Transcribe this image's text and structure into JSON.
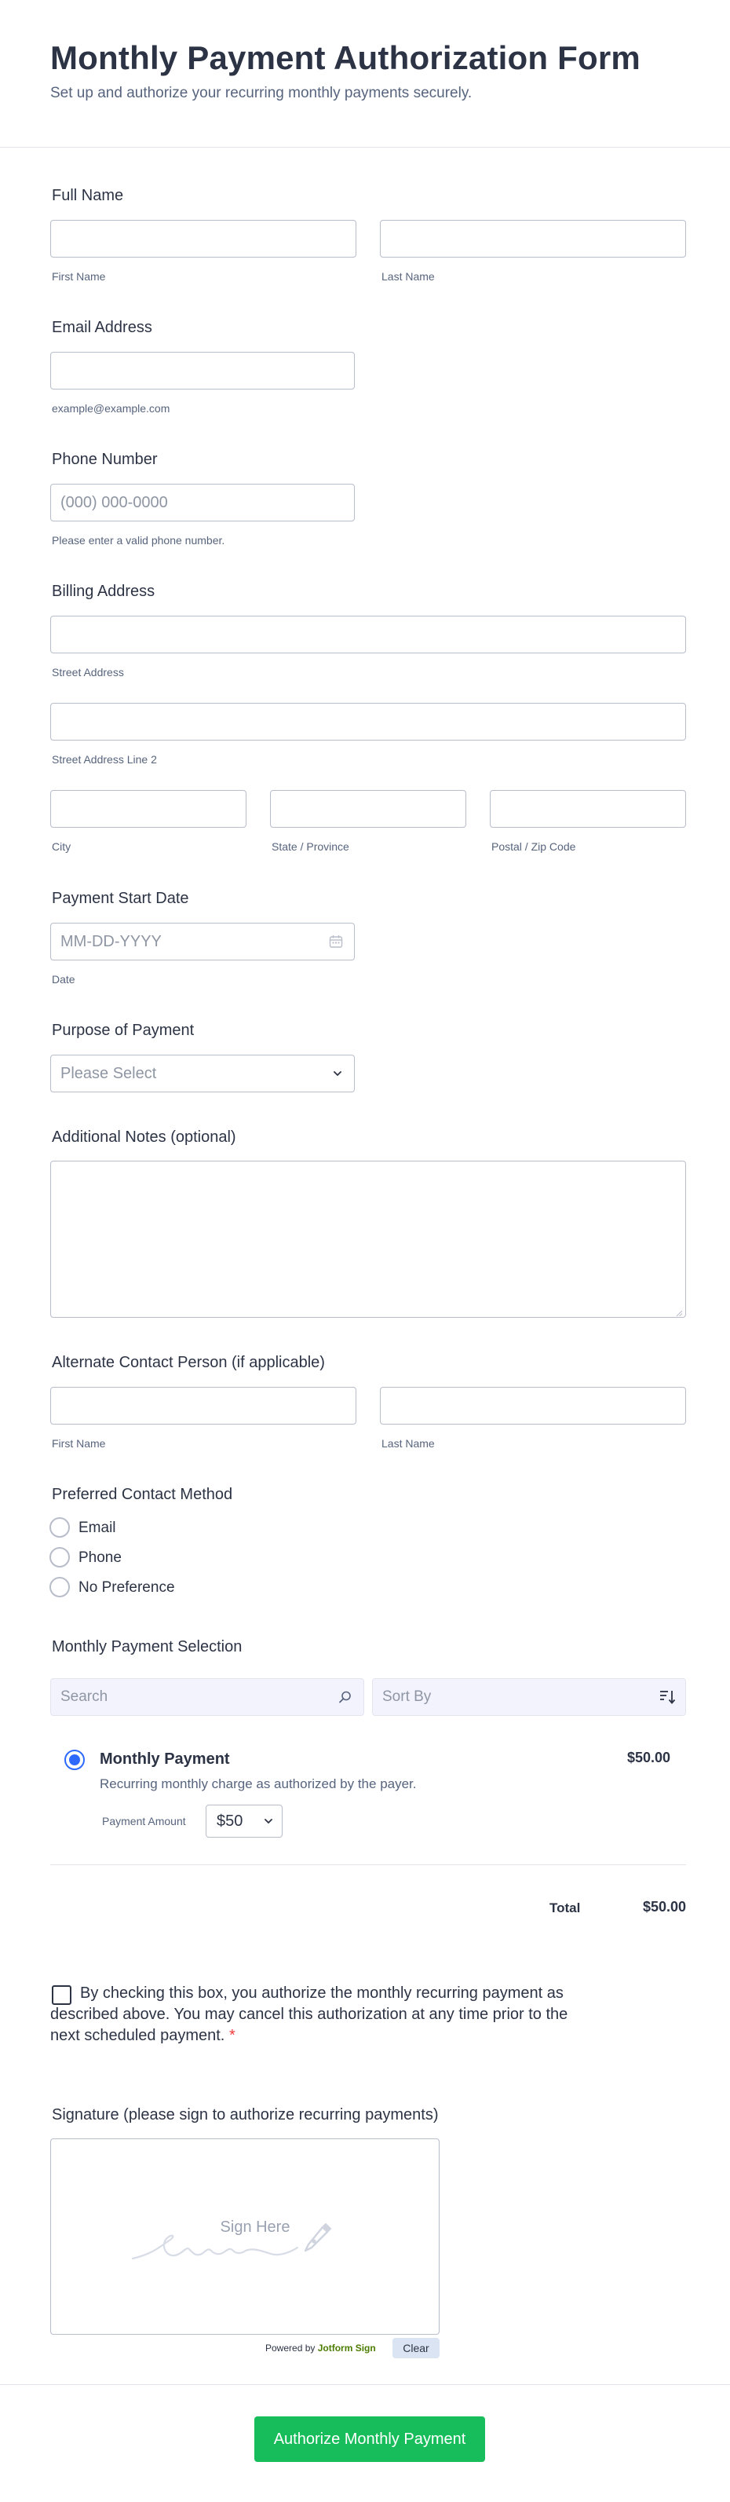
{
  "header": {
    "title": "Monthly Payment Authorization Form",
    "subtitle": "Set up and authorize your recurring monthly payments securely."
  },
  "full_name": {
    "label": "Full Name",
    "first_sub": "First Name",
    "last_sub": "Last Name"
  },
  "email": {
    "label": "Email Address",
    "sub": "example@example.com"
  },
  "phone": {
    "label": "Phone Number",
    "placeholder": "(000) 000-0000",
    "sub": "Please enter a valid phone number."
  },
  "billing": {
    "label": "Billing Address",
    "street_sub": "Street Address",
    "street2_sub": "Street Address Line 2",
    "city_sub": "City",
    "state_sub": "State / Province",
    "zip_sub": "Postal / Zip Code"
  },
  "start_date": {
    "label": "Payment Start Date",
    "placeholder": "MM-DD-YYYY",
    "sub": "Date"
  },
  "purpose": {
    "label": "Purpose of Payment",
    "selected": "Please Select"
  },
  "notes": {
    "label": "Additional Notes (optional)"
  },
  "alt_contact": {
    "label": "Alternate Contact Person (if applicable)",
    "first_sub": "First Name",
    "last_sub": "Last Name"
  },
  "contact_method": {
    "label": "Preferred Contact Method",
    "options": [
      "Email",
      "Phone",
      "No Preference"
    ]
  },
  "payment_selection": {
    "label": "Monthly Payment Selection",
    "search_placeholder": "Search",
    "sort_placeholder": "Sort By",
    "product": {
      "name": "Monthly Payment",
      "description": "Recurring monthly charge as authorized by the payer.",
      "price": "$50.00",
      "amount_label": "Payment Amount",
      "amount_selected": "$50"
    },
    "total_label": "Total",
    "total_value": "$50.00"
  },
  "consent": {
    "line1": "By checking this box, you authorize the monthly recurring payment as",
    "line2": "described above. You may cancel this authorization at any time prior to the",
    "line3": "next scheduled payment.",
    "required_mark": "*"
  },
  "signature": {
    "label": "Signature (please sign to authorize recurring payments)",
    "placeholder": "Sign Here",
    "powered_by": "Powered by",
    "brand": "Jotform Sign",
    "clear_label": "Clear"
  },
  "submit": {
    "label": "Authorize Monthly Payment"
  },
  "colors": {
    "accent": "#18bd5b",
    "radio_selected": "#2e69ff",
    "required": "#f23a3c",
    "brand_green": "#4c7d00"
  }
}
